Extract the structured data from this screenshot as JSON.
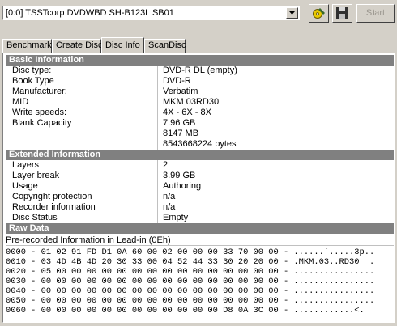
{
  "toolbar": {
    "drive": "[0:0]  TSSTcorp DVDWBD SH-B123L SB01",
    "start_label": "Start"
  },
  "tabs": [
    "Benchmark",
    "Create Disc",
    "Disc Info",
    "ScanDisc"
  ],
  "basic": {
    "title": "Basic Information",
    "rows": [
      {
        "k": "Disc type:",
        "v": "DVD-R DL (empty)"
      },
      {
        "k": "Book Type",
        "v": "DVD-R"
      },
      {
        "k": "Manufacturer:",
        "v": "Verbatim"
      },
      {
        "k": "MID",
        "v": "MKM 03RD30"
      },
      {
        "k": "Write speeds:",
        "v": "4X - 6X - 8X"
      },
      {
        "k": "Blank Capacity",
        "v": "7.96 GB"
      },
      {
        "k": "",
        "v": "8147 MB"
      },
      {
        "k": "",
        "v": "8543668224 bytes"
      }
    ]
  },
  "extended": {
    "title": "Extended Information",
    "rows": [
      {
        "k": "Layers",
        "v": "2"
      },
      {
        "k": "Layer break",
        "v": "3.99 GB"
      },
      {
        "k": "Usage",
        "v": "Authoring"
      },
      {
        "k": "Copyright protection",
        "v": "n/a"
      },
      {
        "k": "Recorder information",
        "v": "n/a"
      },
      {
        "k": "Disc Status",
        "v": "Empty"
      }
    ]
  },
  "raw": {
    "title": "Raw Data",
    "subtitle": "Pre-recorded Information in Lead-in (0Eh)",
    "lines": [
      "0000 - 01 02 91 FD D1 0A 60 00 02 00 00 00 33 70 00 00 - ......`.....3p..",
      "0010 - 03 4D 4B 4D 20 30 33 00 04 52 44 33 30 20 20 00 - .MKM.03..RD30  .",
      "0020 - 05 00 00 00 00 00 00 00 00 00 00 00 00 00 00 00 - ................",
      "0030 - 00 00 00 00 00 00 00 00 00 00 00 00 00 00 00 00 - ................",
      "0040 - 00 00 00 00 00 00 00 00 00 00 00 00 00 00 00 00 - ................",
      "0050 - 00 00 00 00 00 00 00 00 00 00 00 00 00 00 00 00 - ................",
      "0060 - 00 00 00 00 00 00 00 00 00 00 00 00 D8 0A 3C 00 - ............<."
    ]
  }
}
